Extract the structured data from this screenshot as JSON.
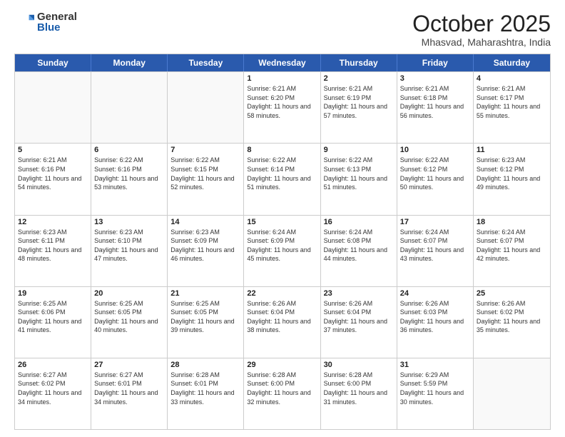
{
  "logo": {
    "general": "General",
    "blue": "Blue"
  },
  "header": {
    "month": "October 2025",
    "location": "Mhasvad, Maharashtra, India"
  },
  "days": [
    "Sunday",
    "Monday",
    "Tuesday",
    "Wednesday",
    "Thursday",
    "Friday",
    "Saturday"
  ],
  "rows": [
    [
      {
        "day": "",
        "sunrise": "",
        "sunset": "",
        "daylight": ""
      },
      {
        "day": "",
        "sunrise": "",
        "sunset": "",
        "daylight": ""
      },
      {
        "day": "",
        "sunrise": "",
        "sunset": "",
        "daylight": ""
      },
      {
        "day": "1",
        "sunrise": "Sunrise: 6:21 AM",
        "sunset": "Sunset: 6:20 PM",
        "daylight": "Daylight: 11 hours and 58 minutes."
      },
      {
        "day": "2",
        "sunrise": "Sunrise: 6:21 AM",
        "sunset": "Sunset: 6:19 PM",
        "daylight": "Daylight: 11 hours and 57 minutes."
      },
      {
        "day": "3",
        "sunrise": "Sunrise: 6:21 AM",
        "sunset": "Sunset: 6:18 PM",
        "daylight": "Daylight: 11 hours and 56 minutes."
      },
      {
        "day": "4",
        "sunrise": "Sunrise: 6:21 AM",
        "sunset": "Sunset: 6:17 PM",
        "daylight": "Daylight: 11 hours and 55 minutes."
      }
    ],
    [
      {
        "day": "5",
        "sunrise": "Sunrise: 6:21 AM",
        "sunset": "Sunset: 6:16 PM",
        "daylight": "Daylight: 11 hours and 54 minutes."
      },
      {
        "day": "6",
        "sunrise": "Sunrise: 6:22 AM",
        "sunset": "Sunset: 6:16 PM",
        "daylight": "Daylight: 11 hours and 53 minutes."
      },
      {
        "day": "7",
        "sunrise": "Sunrise: 6:22 AM",
        "sunset": "Sunset: 6:15 PM",
        "daylight": "Daylight: 11 hours and 52 minutes."
      },
      {
        "day": "8",
        "sunrise": "Sunrise: 6:22 AM",
        "sunset": "Sunset: 6:14 PM",
        "daylight": "Daylight: 11 hours and 51 minutes."
      },
      {
        "day": "9",
        "sunrise": "Sunrise: 6:22 AM",
        "sunset": "Sunset: 6:13 PM",
        "daylight": "Daylight: 11 hours and 51 minutes."
      },
      {
        "day": "10",
        "sunrise": "Sunrise: 6:22 AM",
        "sunset": "Sunset: 6:12 PM",
        "daylight": "Daylight: 11 hours and 50 minutes."
      },
      {
        "day": "11",
        "sunrise": "Sunrise: 6:23 AM",
        "sunset": "Sunset: 6:12 PM",
        "daylight": "Daylight: 11 hours and 49 minutes."
      }
    ],
    [
      {
        "day": "12",
        "sunrise": "Sunrise: 6:23 AM",
        "sunset": "Sunset: 6:11 PM",
        "daylight": "Daylight: 11 hours and 48 minutes."
      },
      {
        "day": "13",
        "sunrise": "Sunrise: 6:23 AM",
        "sunset": "Sunset: 6:10 PM",
        "daylight": "Daylight: 11 hours and 47 minutes."
      },
      {
        "day": "14",
        "sunrise": "Sunrise: 6:23 AM",
        "sunset": "Sunset: 6:09 PM",
        "daylight": "Daylight: 11 hours and 46 minutes."
      },
      {
        "day": "15",
        "sunrise": "Sunrise: 6:24 AM",
        "sunset": "Sunset: 6:09 PM",
        "daylight": "Daylight: 11 hours and 45 minutes."
      },
      {
        "day": "16",
        "sunrise": "Sunrise: 6:24 AM",
        "sunset": "Sunset: 6:08 PM",
        "daylight": "Daylight: 11 hours and 44 minutes."
      },
      {
        "day": "17",
        "sunrise": "Sunrise: 6:24 AM",
        "sunset": "Sunset: 6:07 PM",
        "daylight": "Daylight: 11 hours and 43 minutes."
      },
      {
        "day": "18",
        "sunrise": "Sunrise: 6:24 AM",
        "sunset": "Sunset: 6:07 PM",
        "daylight": "Daylight: 11 hours and 42 minutes."
      }
    ],
    [
      {
        "day": "19",
        "sunrise": "Sunrise: 6:25 AM",
        "sunset": "Sunset: 6:06 PM",
        "daylight": "Daylight: 11 hours and 41 minutes."
      },
      {
        "day": "20",
        "sunrise": "Sunrise: 6:25 AM",
        "sunset": "Sunset: 6:05 PM",
        "daylight": "Daylight: 11 hours and 40 minutes."
      },
      {
        "day": "21",
        "sunrise": "Sunrise: 6:25 AM",
        "sunset": "Sunset: 6:05 PM",
        "daylight": "Daylight: 11 hours and 39 minutes."
      },
      {
        "day": "22",
        "sunrise": "Sunrise: 6:26 AM",
        "sunset": "Sunset: 6:04 PM",
        "daylight": "Daylight: 11 hours and 38 minutes."
      },
      {
        "day": "23",
        "sunrise": "Sunrise: 6:26 AM",
        "sunset": "Sunset: 6:04 PM",
        "daylight": "Daylight: 11 hours and 37 minutes."
      },
      {
        "day": "24",
        "sunrise": "Sunrise: 6:26 AM",
        "sunset": "Sunset: 6:03 PM",
        "daylight": "Daylight: 11 hours and 36 minutes."
      },
      {
        "day": "25",
        "sunrise": "Sunrise: 6:26 AM",
        "sunset": "Sunset: 6:02 PM",
        "daylight": "Daylight: 11 hours and 35 minutes."
      }
    ],
    [
      {
        "day": "26",
        "sunrise": "Sunrise: 6:27 AM",
        "sunset": "Sunset: 6:02 PM",
        "daylight": "Daylight: 11 hours and 34 minutes."
      },
      {
        "day": "27",
        "sunrise": "Sunrise: 6:27 AM",
        "sunset": "Sunset: 6:01 PM",
        "daylight": "Daylight: 11 hours and 34 minutes."
      },
      {
        "day": "28",
        "sunrise": "Sunrise: 6:28 AM",
        "sunset": "Sunset: 6:01 PM",
        "daylight": "Daylight: 11 hours and 33 minutes."
      },
      {
        "day": "29",
        "sunrise": "Sunrise: 6:28 AM",
        "sunset": "Sunset: 6:00 PM",
        "daylight": "Daylight: 11 hours and 32 minutes."
      },
      {
        "day": "30",
        "sunrise": "Sunrise: 6:28 AM",
        "sunset": "Sunset: 6:00 PM",
        "daylight": "Daylight: 11 hours and 31 minutes."
      },
      {
        "day": "31",
        "sunrise": "Sunrise: 6:29 AM",
        "sunset": "Sunset: 5:59 PM",
        "daylight": "Daylight: 11 hours and 30 minutes."
      },
      {
        "day": "",
        "sunrise": "",
        "sunset": "",
        "daylight": ""
      }
    ]
  ]
}
